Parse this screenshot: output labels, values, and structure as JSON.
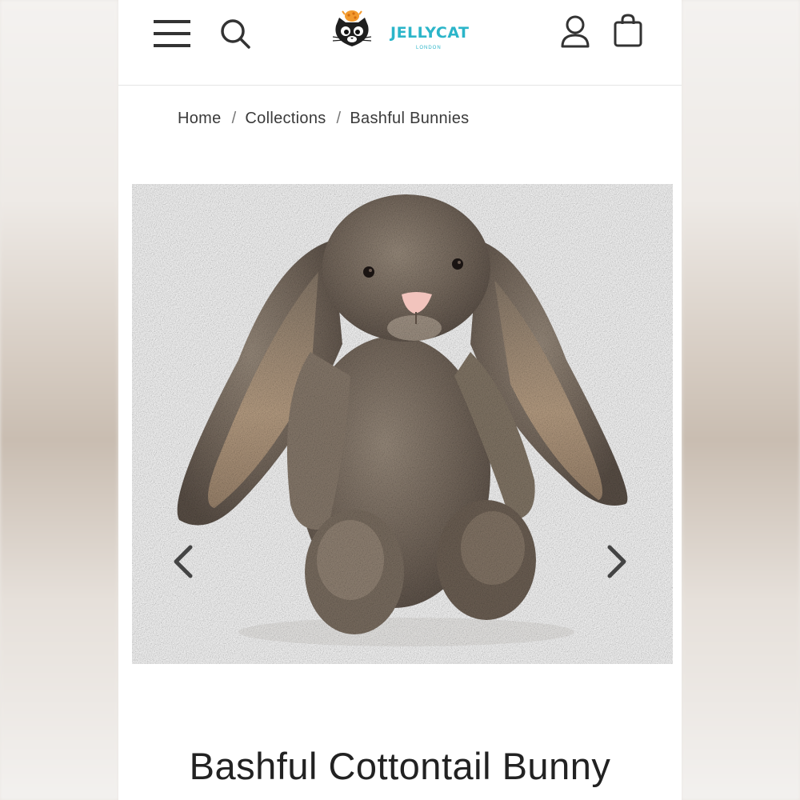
{
  "header": {
    "brand_name": "JELLYCAT",
    "brand_sub": "LONDON",
    "icons": [
      "hamburger-menu-icon",
      "search-icon",
      "account-icon",
      "shopping-bag-icon"
    ]
  },
  "breadcrumb": {
    "items": [
      "Home",
      "Collections",
      "Bashful Bunnies"
    ],
    "separator": "/"
  },
  "gallery": {
    "image_alt": "Bashful Cottontail Bunny",
    "prev_icon": "chevron-left-icon",
    "next_icon": "chevron-right-icon"
  },
  "product": {
    "title": "Bashful Cottontail Bunny"
  },
  "colors": {
    "brand_teal": "#2bb5c9",
    "text": "#222222",
    "icon": "#333333"
  }
}
